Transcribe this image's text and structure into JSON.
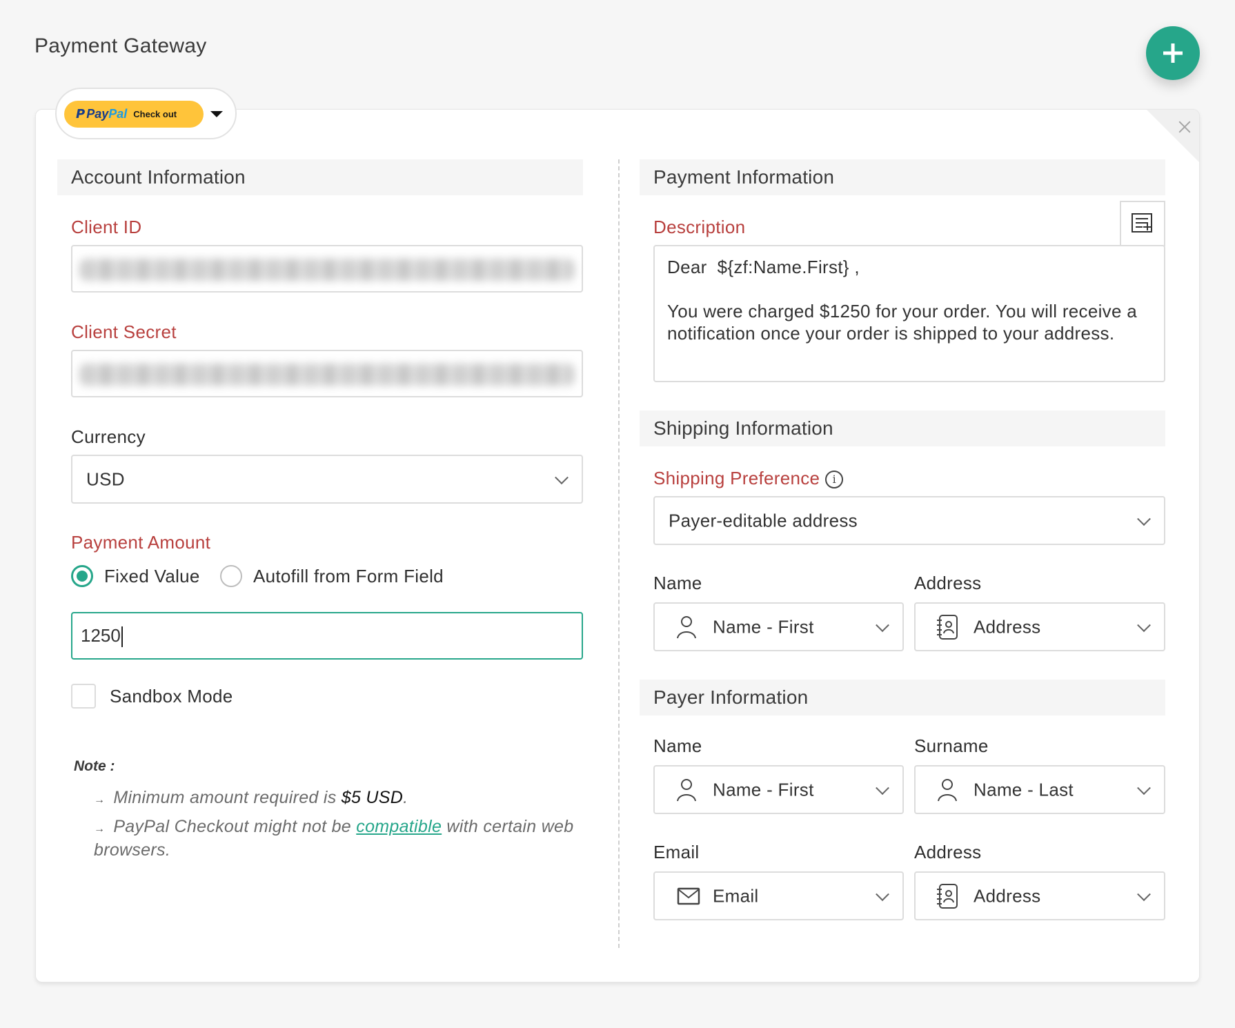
{
  "page": {
    "title": "Payment Gateway",
    "add_button_icon": "plus-icon",
    "close_icon": "close-icon"
  },
  "gateway": {
    "logo_mark": "P",
    "brand_pay": "Pay",
    "brand_pal": "Pal",
    "button_text": "Check out",
    "dropdown_icon": "caret-down-icon"
  },
  "account": {
    "heading": "Account Information",
    "client_id": {
      "label": "Client ID",
      "value": "[redacted]"
    },
    "client_secret": {
      "label": "Client Secret",
      "value": "[redacted]"
    },
    "currency": {
      "label": "Currency",
      "value": "USD"
    },
    "payment_amount": {
      "label": "Payment Amount",
      "options": [
        {
          "label": "Fixed Value",
          "selected": true
        },
        {
          "label": "Autofill from Form Field",
          "selected": false
        }
      ],
      "value": "1250"
    },
    "sandbox": {
      "label": "Sandbox Mode",
      "checked": false
    },
    "note": {
      "title": "Note :",
      "arrow": "→",
      "line1_prefix": "Minimum amount required is ",
      "line1_strong": "$5 USD",
      "line1_suffix": ".",
      "line2_prefix": "PayPal Checkout might not be ",
      "line2_link": "compatible",
      "line2_suffix": " with certain web browsers."
    }
  },
  "payment": {
    "heading": "Payment Information",
    "description": {
      "label": "Description",
      "value": "Dear  ${zf:Name.First} ,\n\nYou were charged $1250 for your order. You will receive a notification once your order is shipped to your address.",
      "insert_icon": "insert-field-icon"
    }
  },
  "shipping": {
    "heading": "Shipping Information",
    "preference": {
      "label": "Shipping Preference",
      "value": "Payer-editable address",
      "info_icon": "i"
    },
    "name": {
      "label": "Name",
      "value": "Name - First"
    },
    "address": {
      "label": "Address",
      "value": "Address"
    }
  },
  "payer": {
    "heading": "Payer Information",
    "name": {
      "label": "Name",
      "value": "Name - First"
    },
    "surname": {
      "label": "Surname",
      "value": "Name - Last"
    },
    "email": {
      "label": "Email",
      "value": "Email"
    },
    "address": {
      "label": "Address",
      "value": "Address"
    }
  },
  "colors": {
    "accent": "#26a68a",
    "required_label": "#b8403e",
    "paypal_yellow": "#ffc43a",
    "paypal_dark_blue": "#173c8a",
    "paypal_light_blue": "#1e9be0"
  }
}
